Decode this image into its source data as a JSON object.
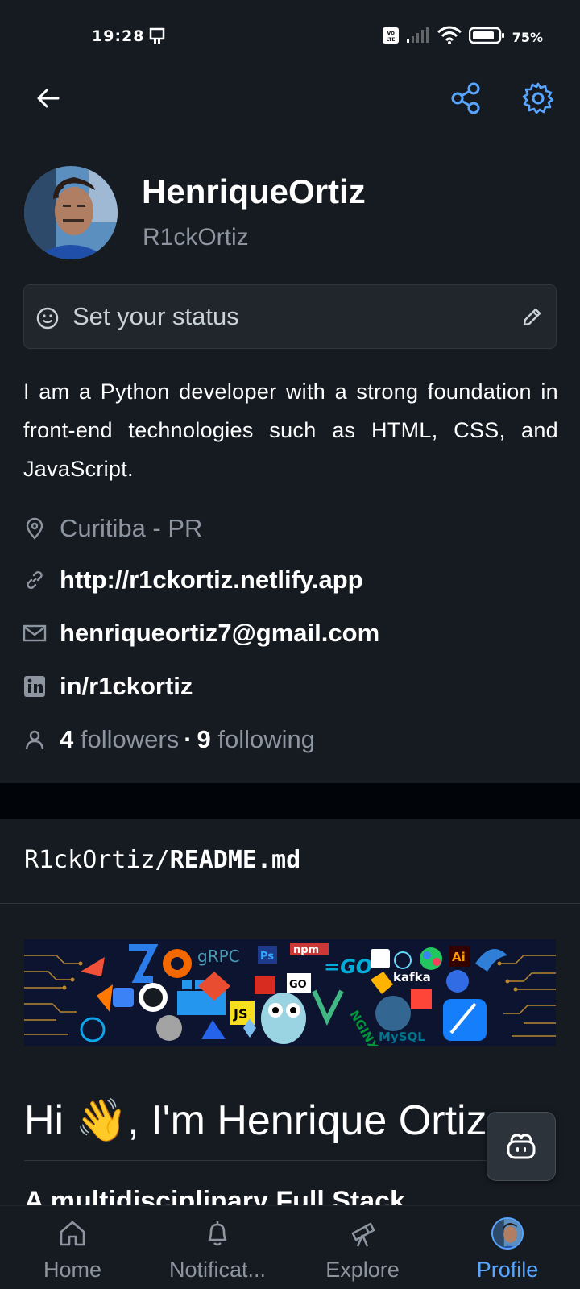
{
  "status_bar": {
    "time": "19:28",
    "battery": "75%"
  },
  "profile": {
    "name": "HenriqueOrtiz",
    "login": "R1ckOrtiz",
    "status_placeholder": "Set your status",
    "bio": "I am a Python developer with a strong foundation in front-end technologies such as HTML, CSS, and JavaScript.",
    "location": "Curitiba - PR",
    "website": "http://r1ckortiz.netlify.app",
    "email": "henriqueortiz7@gmail.com",
    "linkedin": "in/r1ckortiz",
    "followers_count": "4",
    "followers_label": "followers",
    "following_count": "9",
    "following_label": "following"
  },
  "readme": {
    "owner": "R1ckOrtiz/",
    "file": "README.md",
    "banner_words": [
      "gRPC",
      "npm",
      "GO",
      "kafka",
      "MySQL",
      "NGINX",
      "JS",
      "Ps",
      "Ai"
    ],
    "heading": "Hi 👋, I'm Henrique Ortiz",
    "subheading": "A multidisciplinary Full Stack"
  },
  "nav": {
    "home": "Home",
    "notifications": "Notificat...",
    "explore": "Explore",
    "profile": "Profile"
  },
  "colors": {
    "accent": "#58a6ff",
    "background": "#161b22",
    "muted": "#8d96a0"
  }
}
